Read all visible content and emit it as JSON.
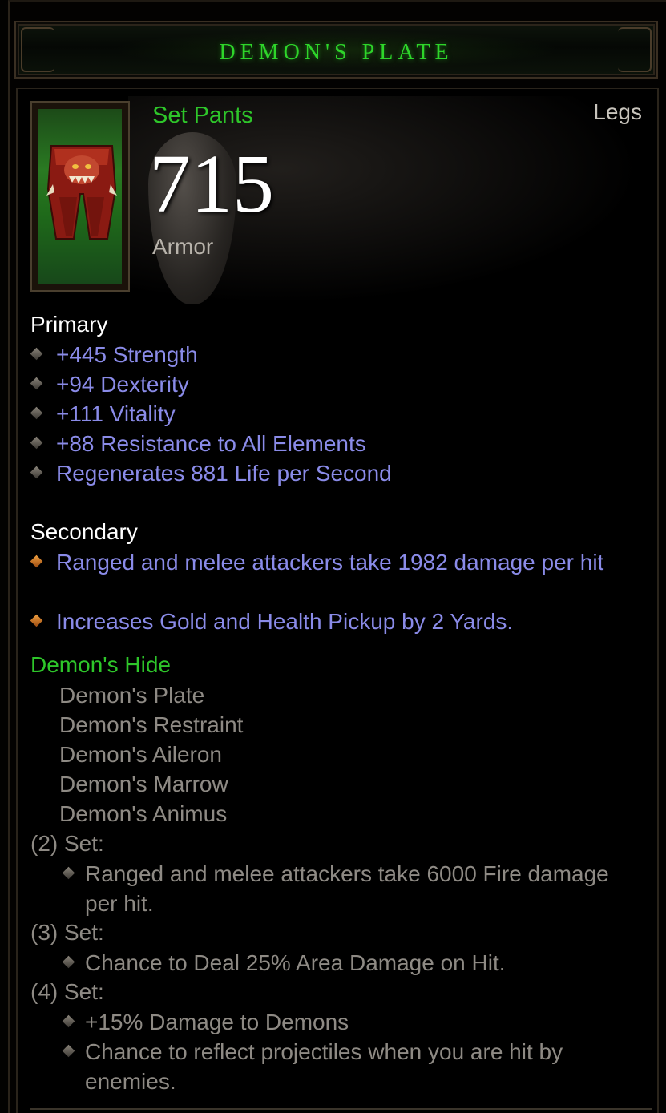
{
  "item": {
    "name": "Demon's Plate",
    "type": "Set Pants",
    "slot": "Legs",
    "armor_value": "715",
    "armor_label": "Armor"
  },
  "primary": {
    "label": "Primary",
    "props": [
      "+445 Strength",
      "+94 Dexterity",
      "+111 Vitality",
      "+88 Resistance to All Elements",
      "Regenerates 881 Life per Second"
    ]
  },
  "secondary": {
    "label": "Secondary",
    "props": [
      "Ranged and melee attackers take 1982 damage per hit",
      "Increases Gold and Health Pickup by 2 Yards."
    ]
  },
  "set": {
    "name": "Demon's Hide",
    "pieces": [
      "Demon's Plate",
      "Demon's Restraint",
      "Demon's Aileron",
      "Demon's Marrow",
      "Demon's Animus"
    ],
    "bonuses": [
      {
        "label": "(2) Set:",
        "effects": [
          "Ranged and melee attackers take 6000 Fire damage per hit."
        ]
      },
      {
        "label": "(3) Set:",
        "effects": [
          "Chance to Deal 25% Area Damage on Hit."
        ]
      },
      {
        "label": "(4) Set:",
        "effects": [
          "+15% Damage to Demons",
          "Chance to reflect projectiles when you are hit by enemies."
        ]
      }
    ]
  },
  "colors": {
    "title_green": "#2ed52a",
    "set_green": "#2ec62a",
    "magic_blue": "#8a8be8",
    "inactive_grey": "#8e8a84"
  },
  "icons": {
    "item": "demon-pants-icon",
    "armor_bg": "shield-icon",
    "bullet": "diamond-bullet-icon"
  }
}
